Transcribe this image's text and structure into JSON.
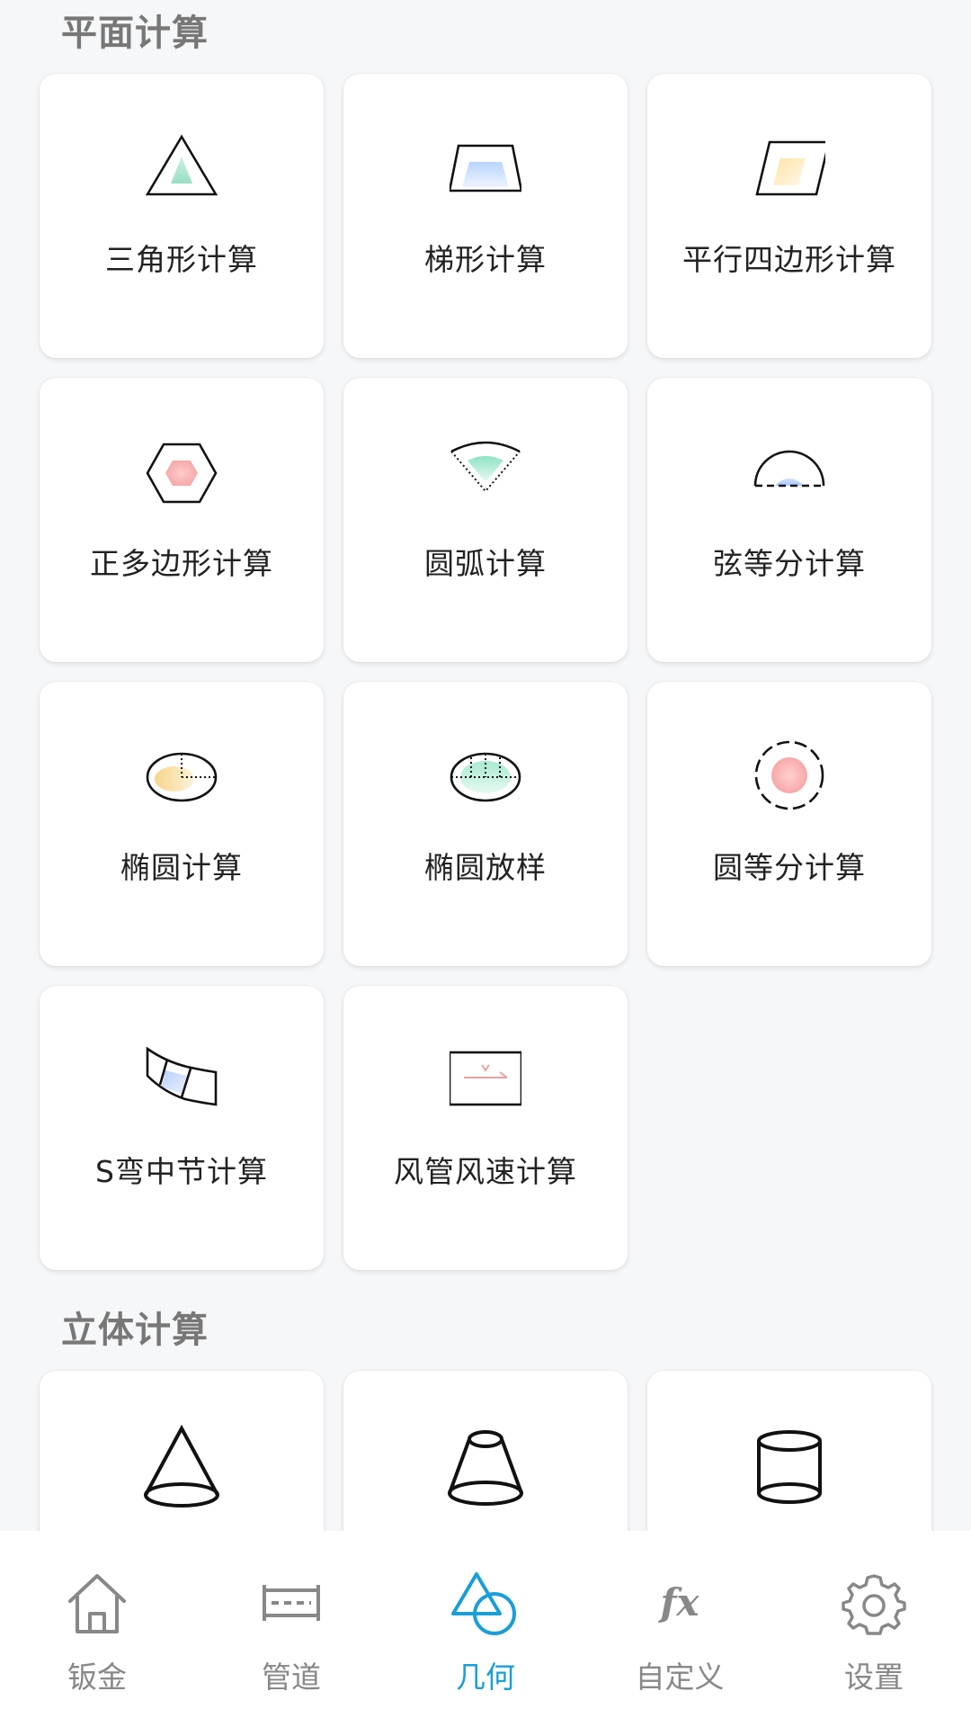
{
  "sections": {
    "plane": {
      "title": "平面计算",
      "cards": [
        {
          "label": "三角形计算",
          "icon": "triangle-icon"
        },
        {
          "label": "梯形计算",
          "icon": "trapezoid-icon"
        },
        {
          "label": "平行四边形计算",
          "icon": "parallelogram-icon"
        },
        {
          "label": "正多边形计算",
          "icon": "hexagon-icon"
        },
        {
          "label": "圆弧计算",
          "icon": "sector-icon"
        },
        {
          "label": "弦等分计算",
          "icon": "semicircle-chord-icon"
        },
        {
          "label": "椭圆计算",
          "icon": "ellipse-icon"
        },
        {
          "label": "椭圆放样",
          "icon": "ellipse-layout-icon"
        },
        {
          "label": "圆等分计算",
          "icon": "dashed-circle-icon"
        },
        {
          "label": "S弯中节计算",
          "icon": "s-bend-icon"
        },
        {
          "label": "风管风速计算",
          "icon": "duct-velocity-icon"
        }
      ]
    },
    "solid": {
      "title": "立体计算",
      "cards": [
        {
          "icon": "cone-icon"
        },
        {
          "icon": "frustum-icon"
        },
        {
          "icon": "cylinder-icon"
        }
      ]
    }
  },
  "nav": [
    {
      "label": "钣金",
      "icon": "home-icon"
    },
    {
      "label": "管道",
      "icon": "pipe-icon"
    },
    {
      "label": "几何",
      "icon": "geometry-icon",
      "active": true
    },
    {
      "label": "自定义",
      "icon": "fx-icon"
    },
    {
      "label": "设置",
      "icon": "gear-icon"
    }
  ],
  "colors": {
    "accent": "#1a9ed9",
    "inactive": "#888888"
  }
}
